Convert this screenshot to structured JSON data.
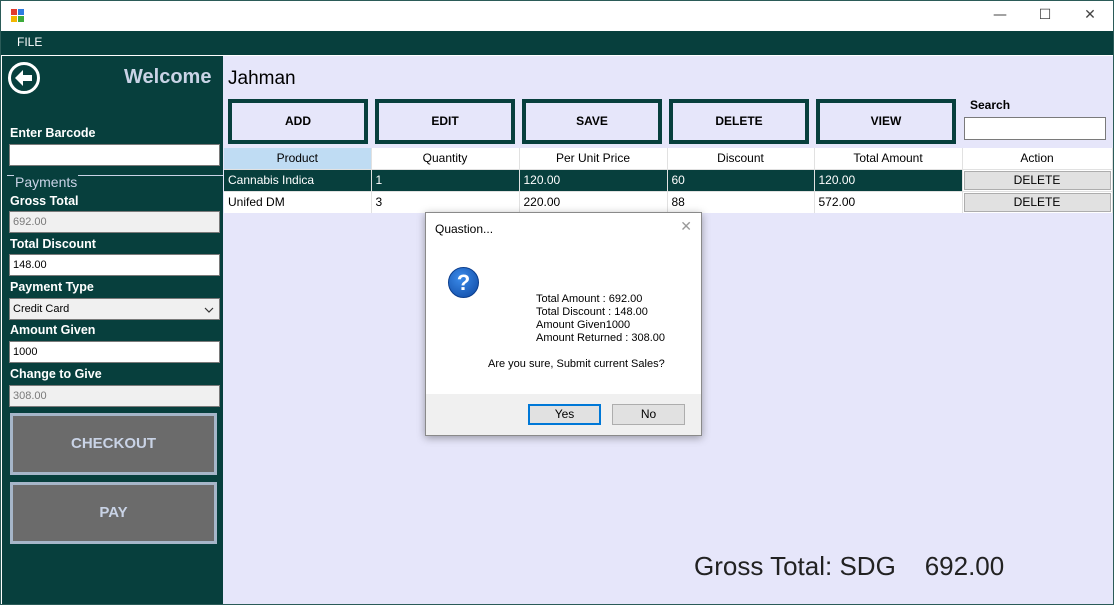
{
  "window": {
    "minimize_glyph": "—",
    "maximize_glyph": "☐",
    "close_glyph": "✕"
  },
  "menu": {
    "file_label": "FILE"
  },
  "sidebar": {
    "welcome": "Welcome",
    "barcode_label": "Enter Barcode",
    "barcode_value": "",
    "payments_legend": "Payments",
    "gross_total_label": "Gross Total",
    "gross_total_value": "692.00",
    "total_discount_label": "Total Discount",
    "total_discount_value": "148.00",
    "payment_type_label": "Payment Type",
    "payment_type_value": "Credit Card",
    "amount_given_label": "Amount Given",
    "amount_given_value": "1000",
    "change_label": "Change to Give",
    "change_value": "308.00",
    "checkout_label": "CHECKOUT",
    "pay_label": "PAY"
  },
  "main": {
    "user_name": "Jahman",
    "toolbar": {
      "add": "ADD",
      "edit": "EDIT",
      "save": "SAVE",
      "delete": "DELETE",
      "view": "VIEW"
    },
    "search_label": "Search",
    "search_value": "",
    "columns": [
      "Product",
      "Quantity",
      "Per Unit Price",
      "Discount",
      "Total Amount",
      "Action"
    ],
    "rows": [
      {
        "product": "Cannabis Indica",
        "quantity": "1",
        "unit_price": "120.00",
        "discount": "60",
        "total": "120.00",
        "action": "DELETE"
      },
      {
        "product": "Unifed DM",
        "quantity": "3",
        "unit_price": "220.00",
        "discount": "88",
        "total": "572.00",
        "action": "DELETE"
      }
    ],
    "gross_footer": "Gross Total: SDG    692.00"
  },
  "dialog": {
    "title": "Quastion...",
    "close_glyph": "✕",
    "icon": "question-icon",
    "lines": [
      "Total Amount : 692.00",
      "Total Discount : 148.00",
      "Amount Given1000",
      "Amount Returned : 308.00"
    ],
    "confirm": "Are you sure, Submit current Sales?",
    "yes": "Yes",
    "no": "No"
  },
  "colors": {
    "accent": "#073f3d",
    "main_bg": "#e6e6fa",
    "header_selected": "#bfdcf3",
    "primary_border": "#0078d7"
  }
}
